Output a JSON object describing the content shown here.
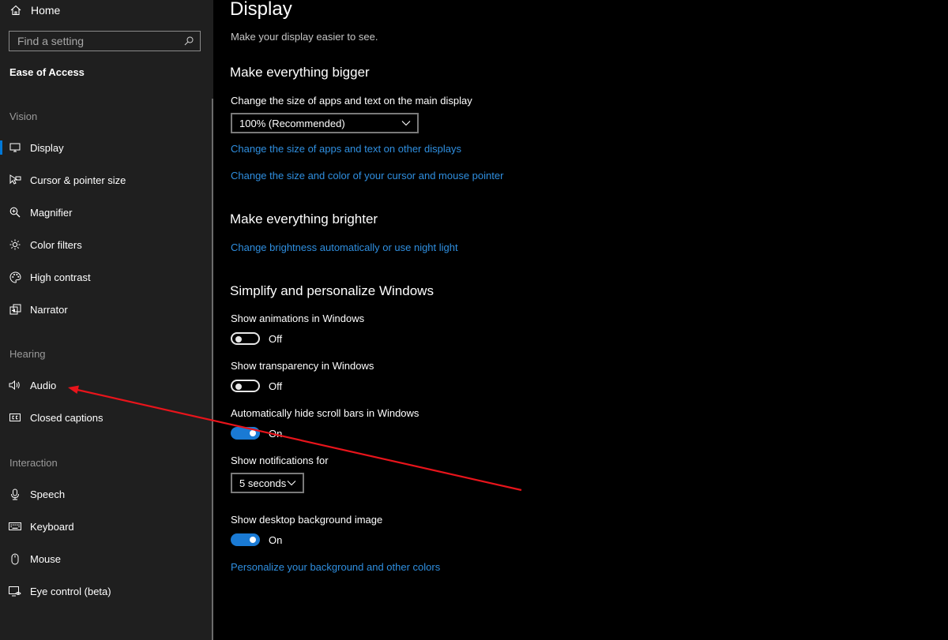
{
  "colors": {
    "accent": "#0078d7",
    "link": "#2f8fe0",
    "toggle_on": "#1a7ad4",
    "annotation": "#e8141b"
  },
  "sidebar": {
    "home_label": "Home",
    "search_placeholder": "Find a setting",
    "section_title": "Ease of Access",
    "groups": {
      "vision": "Vision",
      "hearing": "Hearing",
      "interaction": "Interaction"
    },
    "items": [
      {
        "label": "Display",
        "icon": "display-icon",
        "active": true
      },
      {
        "label": "Cursor & pointer size",
        "icon": "cursor-pointer-icon"
      },
      {
        "label": "Magnifier",
        "icon": "magnifier-icon"
      },
      {
        "label": "Color filters",
        "icon": "color-filters-icon"
      },
      {
        "label": "High contrast",
        "icon": "high-contrast-icon"
      },
      {
        "label": "Narrator",
        "icon": "narrator-icon"
      },
      {
        "label": "Audio",
        "icon": "audio-icon"
      },
      {
        "label": "Closed captions",
        "icon": "closed-captions-icon"
      },
      {
        "label": "Speech",
        "icon": "microphone-icon"
      },
      {
        "label": "Keyboard",
        "icon": "keyboard-icon"
      },
      {
        "label": "Mouse",
        "icon": "mouse-icon"
      },
      {
        "label": "Eye control (beta)",
        "icon": "eye-control-icon"
      }
    ]
  },
  "main": {
    "title": "Display",
    "subtitle": "Make your display easier to see.",
    "bigger": {
      "heading": "Make everything bigger",
      "scale_label": "Change the size of apps and text on the main display",
      "scale_value": "100% (Recommended)",
      "link_other_displays": "Change the size of apps and text on other displays",
      "link_cursor": "Change the size and color of your cursor and mouse pointer"
    },
    "brighter": {
      "heading": "Make everything brighter",
      "link_brightness": "Change brightness automatically or use night light"
    },
    "simplify": {
      "heading": "Simplify and personalize Windows",
      "animations_label": "Show animations in Windows",
      "animations_state": "Off",
      "transparency_label": "Show transparency in Windows",
      "transparency_state": "Off",
      "scrollbars_label": "Automatically hide scroll bars in Windows",
      "scrollbars_state": "On",
      "notifications_label": "Show notifications for",
      "notifications_value": "5 seconds",
      "background_label": "Show desktop background image",
      "background_state": "On",
      "link_personalize": "Personalize your background and other colors"
    }
  }
}
